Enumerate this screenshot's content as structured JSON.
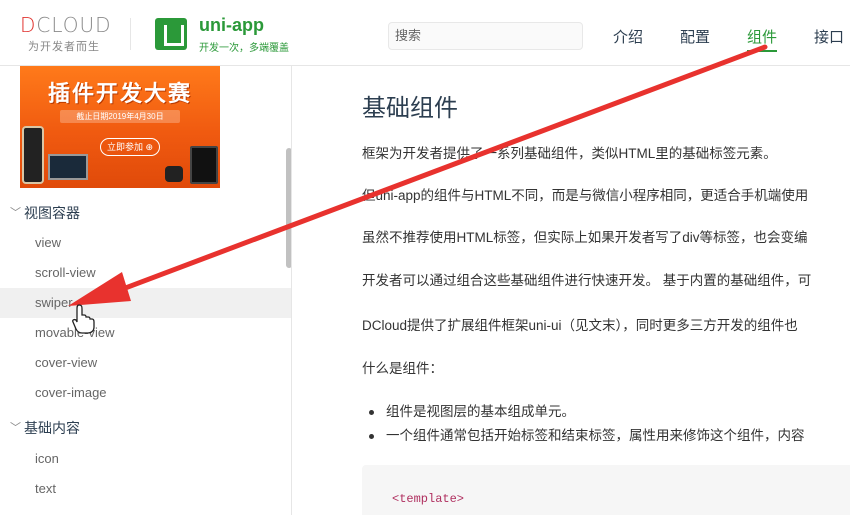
{
  "header": {
    "brand": {
      "dcloud_prefix": "D",
      "dcloud_rest": "CLOUD",
      "slogan": "为开发者而生"
    },
    "product": {
      "title": "uni-app",
      "subtitle": "开发一次，多端覆盖"
    },
    "search": {
      "placeholder": "搜索"
    },
    "nav": [
      {
        "label": "介绍",
        "active": false
      },
      {
        "label": "配置",
        "active": false
      },
      {
        "label": "组件",
        "active": true
      },
      {
        "label": "接口",
        "active": false
      }
    ],
    "accent_color": "#2b9939"
  },
  "sidebar": {
    "banner": {
      "title": "插件开发大赛",
      "date": "截止日期2019年4月30日",
      "button": "立即参加 ⊕"
    },
    "groups": [
      {
        "label": "视图容器",
        "chevron": "chevron-down-icon",
        "items": [
          "view",
          "scroll-view",
          "swiper",
          "movable-view",
          "cover-view",
          "cover-image"
        ]
      },
      {
        "label": "基础内容",
        "chevron": "chevron-down-icon",
        "items": [
          "icon",
          "text"
        ]
      }
    ],
    "hovered_item": "swiper"
  },
  "main": {
    "title": "基础组件",
    "paragraphs": [
      "框架为开发者提供了一系列基础组件，类似HTML里的基础标签元素。",
      "但uni-app的组件与HTML不同，而是与微信小程序相同，更适合手机端使用",
      "虽然不推荐使用HTML标签，但实际上如果开发者写了div等标签，也会变编",
      "开发者可以通过组合这些基础组件进行快速开发。 基于内置的基础组件，可",
      "DCloud提供了扩展组件框架uni-ui（见文末），同时更多三方开发的组件也",
      "什么是组件："
    ],
    "bullets": [
      "组件是视图层的基本组成单元。",
      "一个组件通常包括开始标签和结束标签，属性用来修饰这个组件，内容"
    ],
    "code": "<template>"
  },
  "annotation": {
    "arrow_color": "#e8322e"
  }
}
